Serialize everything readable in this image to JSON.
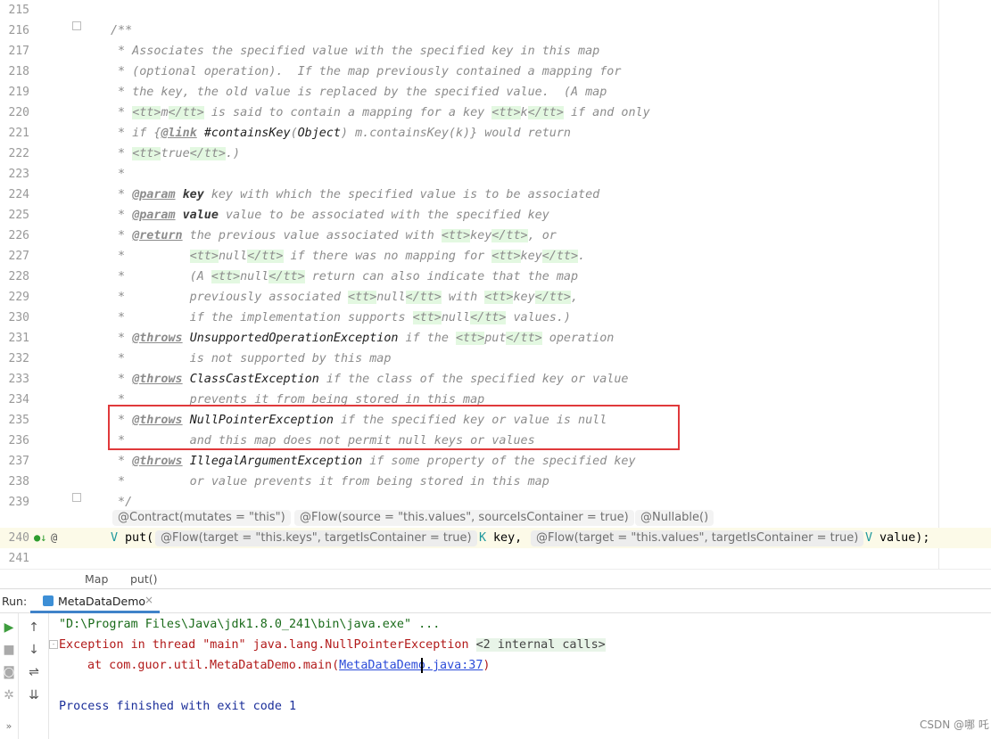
{
  "editor": {
    "lines": [
      {
        "num": "215",
        "segments": []
      },
      {
        "num": "216",
        "segments": [
          [
            "t",
            "/**"
          ]
        ]
      },
      {
        "num": "217",
        "segments": [
          [
            "t",
            " * Associates the specified value with the specified key in this map"
          ]
        ]
      },
      {
        "num": "218",
        "segments": [
          [
            "t",
            " * (optional operation).  If the map previously contained a mapping for"
          ]
        ]
      },
      {
        "num": "219",
        "segments": [
          [
            "t",
            " * the key, the old value is replaced by the specified value.  (A map"
          ]
        ]
      },
      {
        "num": "220",
        "segments": [
          [
            "t",
            " * "
          ],
          [
            "tag",
            "<tt>"
          ],
          [
            "t",
            "m"
          ],
          [
            "tag",
            "</tt>"
          ],
          [
            "t",
            " is said to contain a mapping for a key "
          ],
          [
            "tag",
            "<tt>"
          ],
          [
            "t",
            "k"
          ],
          [
            "tag",
            "</tt>"
          ],
          [
            "t",
            " if and only"
          ]
        ]
      },
      {
        "num": "221",
        "segments": [
          [
            "t",
            " * if {"
          ],
          [
            "jtag",
            "@link"
          ],
          [
            "t",
            " "
          ],
          [
            "link",
            "#containsKey"
          ],
          [
            "t",
            "("
          ],
          [
            "link",
            "Object"
          ],
          [
            "t",
            ") m.containsKey(k)} would return"
          ]
        ]
      },
      {
        "num": "222",
        "segments": [
          [
            "t",
            " * "
          ],
          [
            "tag",
            "<tt>"
          ],
          [
            "t",
            "true"
          ],
          [
            "tag",
            "</tt>"
          ],
          [
            "t",
            ".)"
          ]
        ]
      },
      {
        "num": "223",
        "segments": [
          [
            "t",
            " *"
          ]
        ]
      },
      {
        "num": "224",
        "segments": [
          [
            "t",
            " * "
          ],
          [
            "jtag",
            "@param"
          ],
          [
            "t",
            " "
          ],
          [
            "pname",
            "key"
          ],
          [
            "t",
            " key with which the specified value is to be associated"
          ]
        ]
      },
      {
        "num": "225",
        "segments": [
          [
            "t",
            " * "
          ],
          [
            "jtag",
            "@param"
          ],
          [
            "t",
            " "
          ],
          [
            "pname",
            "value"
          ],
          [
            "t",
            " value to be associated with the specified key"
          ]
        ]
      },
      {
        "num": "226",
        "segments": [
          [
            "t",
            " * "
          ],
          [
            "jtag",
            "@return"
          ],
          [
            "t",
            " the previous value associated with "
          ],
          [
            "tag",
            "<tt>"
          ],
          [
            "t",
            "key"
          ],
          [
            "tag",
            "</tt>"
          ],
          [
            "t",
            ", or"
          ]
        ]
      },
      {
        "num": "227",
        "segments": [
          [
            "t",
            " *         "
          ],
          [
            "tag",
            "<tt>"
          ],
          [
            "t",
            "null"
          ],
          [
            "tag",
            "</tt>"
          ],
          [
            "t",
            " if there was no mapping for "
          ],
          [
            "tag",
            "<tt>"
          ],
          [
            "t",
            "key"
          ],
          [
            "tag",
            "</tt>"
          ],
          [
            "t",
            "."
          ]
        ]
      },
      {
        "num": "228",
        "segments": [
          [
            "t",
            " *         (A "
          ],
          [
            "tag",
            "<tt>"
          ],
          [
            "t",
            "null"
          ],
          [
            "tag",
            "</tt>"
          ],
          [
            "t",
            " return can also indicate that the map"
          ]
        ]
      },
      {
        "num": "229",
        "segments": [
          [
            "t",
            " *         previously associated "
          ],
          [
            "tag",
            "<tt>"
          ],
          [
            "t",
            "null"
          ],
          [
            "tag",
            "</tt>"
          ],
          [
            "t",
            " with "
          ],
          [
            "tag",
            "<tt>"
          ],
          [
            "t",
            "key"
          ],
          [
            "tag",
            "</tt>"
          ],
          [
            "t",
            ","
          ]
        ]
      },
      {
        "num": "230",
        "segments": [
          [
            "t",
            " *         if the implementation supports "
          ],
          [
            "tag",
            "<tt>"
          ],
          [
            "t",
            "null"
          ],
          [
            "tag",
            "</tt>"
          ],
          [
            "t",
            " values.)"
          ]
        ]
      },
      {
        "num": "231",
        "segments": [
          [
            "t",
            " * "
          ],
          [
            "jtag",
            "@throws"
          ],
          [
            "t",
            " "
          ],
          [
            "cls",
            "UnsupportedOperationException"
          ],
          [
            "t",
            " if the "
          ],
          [
            "tag",
            "<tt>"
          ],
          [
            "t",
            "put"
          ],
          [
            "tag",
            "</tt>"
          ],
          [
            "t",
            " operation"
          ]
        ]
      },
      {
        "num": "232",
        "segments": [
          [
            "t",
            " *         is not supported by this map"
          ]
        ]
      },
      {
        "num": "233",
        "segments": [
          [
            "t",
            " * "
          ],
          [
            "jtag",
            "@throws"
          ],
          [
            "t",
            " "
          ],
          [
            "cls",
            "ClassCastException"
          ],
          [
            "t",
            " if the class of the specified key or value"
          ]
        ]
      },
      {
        "num": "234",
        "segments": [
          [
            "t",
            " *         prevents it from being stored in this map"
          ]
        ]
      },
      {
        "num": "235",
        "segments": [
          [
            "t",
            " * "
          ],
          [
            "jtag",
            "@throws"
          ],
          [
            "t",
            " "
          ],
          [
            "cls",
            "NullPointerException"
          ],
          [
            "t",
            " if the specified key or value is null"
          ]
        ]
      },
      {
        "num": "236",
        "segments": [
          [
            "t",
            " *         and this map does not permit null keys or values"
          ]
        ]
      },
      {
        "num": "237",
        "segments": [
          [
            "t",
            " * "
          ],
          [
            "jtag",
            "@throws"
          ],
          [
            "t",
            " "
          ],
          [
            "cls",
            "IllegalArgumentException"
          ],
          [
            "t",
            " if some property of the specified key"
          ]
        ]
      },
      {
        "num": "238",
        "segments": [
          [
            "t",
            " *         or value prevents it from being stored in this map"
          ]
        ]
      },
      {
        "num": "239",
        "segments": [
          [
            "t",
            " */"
          ]
        ]
      }
    ],
    "annotations": [
      "@Contract(mutates = \"this\")",
      "@Flow(source = \"this.values\", sourceIsContainer = true)",
      "@Nullable()"
    ],
    "sig": {
      "num": "240",
      "type1": "V",
      "method": "put(",
      "inlay1": "@Flow(target = \"this.keys\", targetIsContainer = true)",
      "type2": "K",
      "param1": "key,",
      "inlay2": "@Flow(target = \"this.values\", targetIsContainer = true)",
      "type3": "V",
      "param2": "value);"
    },
    "last_line": "241"
  },
  "breadcrumb": {
    "items": [
      "Map",
      "put()"
    ]
  },
  "run": {
    "label": "Run:",
    "tab": "MetaDataDemo",
    "tab_close": "×",
    "console": {
      "cmd": "\"D:\\Program Files\\Java\\jdk1.8.0_241\\bin\\java.exe\" ...",
      "err": "Exception in thread \"main\" java.lang.NullPointerException",
      "internal": "<2 internal calls>",
      "at_prefix": "at com.guor.util.MetaDataDemo.main(",
      "at_link": "MetaDataDemo.java:37",
      "at_suffix": ")",
      "exit": "Process finished with exit code 1"
    }
  },
  "watermark": "CSDN @哪 吒",
  "colors": {
    "highlight_box": "#e0393b",
    "tag_bg": "#e3f8e1",
    "error": "#b21a1a",
    "link": "#2b4bd9"
  }
}
